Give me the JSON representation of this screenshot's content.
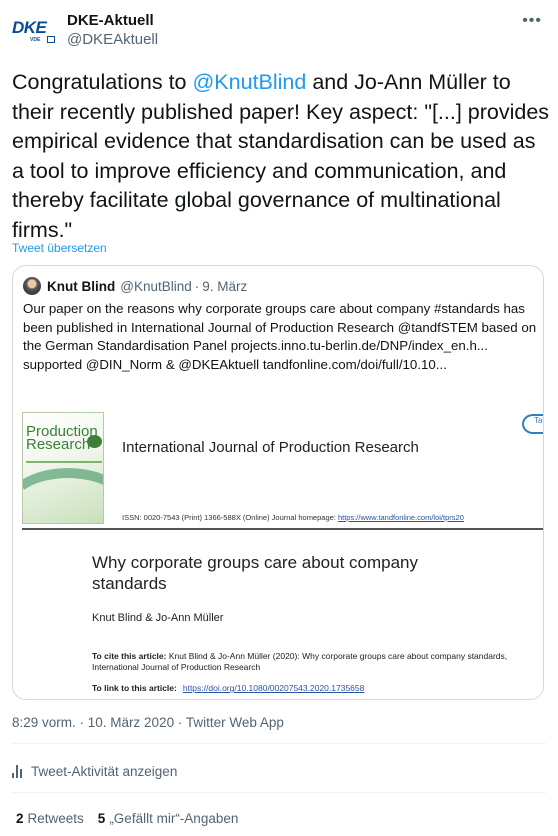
{
  "author": {
    "display_name": "DKE-Aktuell",
    "handle": "@DKEAktuell",
    "avatar_logo": "DKE",
    "avatar_sub": "VDE"
  },
  "more_icon": "•••",
  "tweet": {
    "text_1": "Congratulations to ",
    "mention": "@KnutBlind",
    "text_2": " and Jo-Ann Müller to their recently published paper! Key aspect: \"[...] provides empirical evidence that standardisation can be used as a tool to improve efficiency and communication, and thereby facilitate global governance of multinational firms.\"",
    "translate_label": "Tweet übersetzen"
  },
  "quote": {
    "name": "Knut Blind",
    "handle": "@KnutBlind",
    "separator": "·",
    "date": "9. März",
    "text": "Our paper on the reasons why corporate groups care about company #standards has been published in International Journal of Production Research @tandfSTEM based on the German Standardisation Panel projects.inno.tu-berlin.de/DNP/index_en.h... supported @DIN_Norm & @DKEAktuell tandfonline.com/doi/full/10.10..."
  },
  "paper": {
    "cover_title": "Production Research",
    "journal_title": "International Journal of Production Research",
    "publisher": "Taylor",
    "issn_text": "ISSN: 0020-7543 (Print) 1366-588X (Online) Journal homepage: ",
    "issn_link": "https://www.tandfonline.com/loi/tprs20",
    "article_title": "Why corporate groups care about company standards",
    "authors": "Knut Blind & Jo-Ann Müller",
    "cite_label": "To cite this article:",
    "cite_text": " Knut Blind & Jo-Ann Müller (2020): Why corporate groups care about company standards, International Journal of Production Research",
    "link_label": "To link to this article:",
    "link_url": "https://doi.org/10.1080/00207543.2020.1735658"
  },
  "meta": "8:29 vorm. · 10. März 2020 · Twitter Web App",
  "activity_label": "Tweet-Aktivität anzeigen",
  "stats": {
    "retweets_count": "2",
    "retweets_label": "Retweets",
    "likes_count": "5",
    "likes_label": "„Gefällt mir“-Angaben"
  }
}
